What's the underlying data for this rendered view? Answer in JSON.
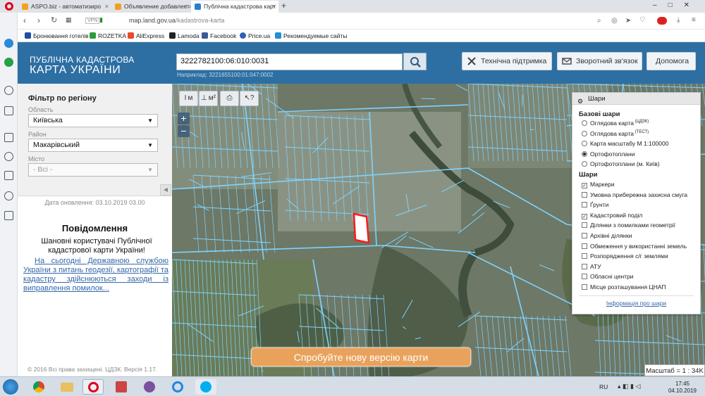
{
  "browser": {
    "tabs": [
      {
        "label": "ASPO.biz - автоматизиро",
        "color": "#f4a11c"
      },
      {
        "label": "Объявление добавлестся",
        "color": "#f0a020"
      },
      {
        "label": "Публічна кадастрова карт",
        "color": "#2b7fcf"
      }
    ],
    "new_tab": "+",
    "address": {
      "protocol_badge": "VPN",
      "host": "map.land.gov.ua",
      "path": "/kadastrova-karta"
    },
    "bookmarks": [
      {
        "label": "Бронювання готелів",
        "color": "#1d4fa5"
      },
      {
        "label": "ROZETKA",
        "color": "#2a9d3a"
      },
      {
        "label": "AliExpress",
        "color": "#e74c2b"
      },
      {
        "label": "Lamoda",
        "color": "#222222"
      },
      {
        "label": "Facebook",
        "color": "#3b5998"
      },
      {
        "label": "Price.ua",
        "color": "#2f5fb3"
      },
      {
        "label": "Рекомендуемые сайты",
        "color": "#1f8fd6"
      }
    ]
  },
  "site": {
    "brand_line1": "ПУБЛІЧНА КАДАСТРОВА",
    "brand_line2": "КАРТА УКРАЇНИ",
    "search": {
      "value": "3222782100:06:010:0031",
      "hint": "Наприклад: 3221655100:01:047:0002"
    },
    "buttons": {
      "support": "Технічна підтримка",
      "feedback": "Зворотний зв'язок",
      "help": "Допомога"
    }
  },
  "filter": {
    "title": "Фільтр по регіону",
    "region_label": "Область",
    "region_value": "Київська",
    "district_label": "Район",
    "district_value": "Макарівський",
    "city_label": "Місто",
    "city_value": "- Всі -",
    "updated": "Дата оновлення: 03.10.2019 03.00"
  },
  "notice": {
    "title": "Повідомлення",
    "body": "Шановні користувачі Публічної кадастрової карти України!",
    "link": "На сьогодні Державною службою України з питань геодезії, картографії та кадастру здійснюються заходи із виправлення помилок...",
    "copyright": "© 2016 Всі права захищені. ЦДЗК. Версія 1.17."
  },
  "map": {
    "tools": [
      "I м",
      "I⊥ м²",
      "print",
      "?"
    ],
    "zoom_in": "+",
    "zoom_out": "−",
    "new_version": "Спробуйте нову версію карти",
    "scale": "Масштаб = 1 : 34K",
    "highlight_color": "#ff1a1a",
    "parcel_color": "#7fd3ff"
  },
  "layers": {
    "title": "Шари",
    "base_title": "Базові шари",
    "base": [
      {
        "label": "Оглядова карта",
        "sup": "(ЦДЗК)",
        "on": false
      },
      {
        "label": "Оглядова карта",
        "sup": "(ТЕСТ)",
        "on": false
      },
      {
        "label": "Карта масштабу М 1:100000",
        "sup": "",
        "on": false
      },
      {
        "label": "Ортофотоплани",
        "sup": "",
        "on": true
      },
      {
        "label": "Ортофотоплани (м. Київ)",
        "sup": "",
        "on": false
      }
    ],
    "layers_title": "Шари",
    "items": [
      {
        "label": "Маркери",
        "on": true
      },
      {
        "label": "Умовна прибережна захисна смуга",
        "on": false
      },
      {
        "label": "Ґрунти",
        "on": false
      },
      {
        "label": "Кадастровий поділ",
        "on": true
      },
      {
        "label": "Ділянки з помилками геометрії",
        "on": false
      },
      {
        "label": "Архівні ділянки",
        "on": false
      },
      {
        "label": "Обмеження у використанні земель",
        "on": false
      },
      {
        "label": "Розпорядження с/г землями",
        "on": false
      },
      {
        "label": "АТУ",
        "on": false
      },
      {
        "label": "Обласні центри",
        "on": false
      },
      {
        "label": "Місце розташування ЦНАП",
        "on": false
      }
    ],
    "info_link": "Інформація про шари"
  },
  "taskbar": {
    "lang": "RU",
    "time": "17:45",
    "date": "04.10.2019"
  }
}
